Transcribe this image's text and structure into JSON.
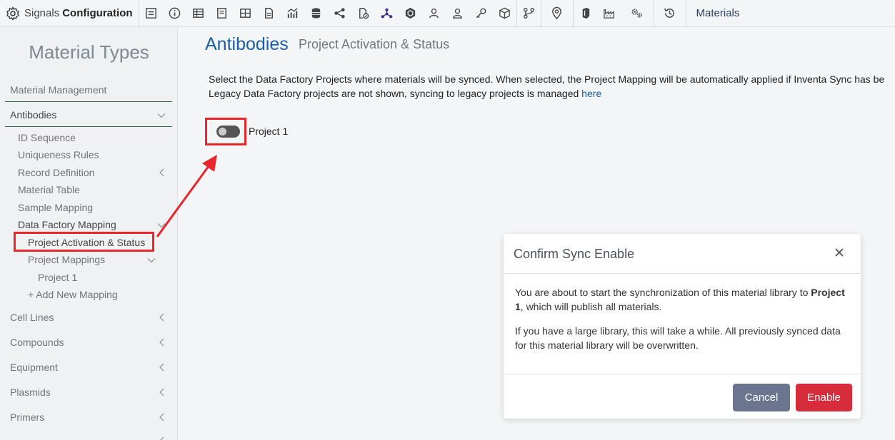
{
  "topbar": {
    "brand_prefix": "Signals",
    "brand_name": "Configuration",
    "section_label": "Materials",
    "icons": [
      "gear-icon",
      "form-icon",
      "info-icon",
      "table-icon",
      "notebook-icon",
      "grid-icon",
      "document-icon",
      "chart-icon",
      "database-icon",
      "share-icon",
      "doc-check-icon",
      "network-icon",
      "hexagon-icon",
      "user-group-icon",
      "user-icon",
      "key-icon",
      "cube-icon",
      "workflow-icon",
      "location-icon",
      "shield-icon",
      "factory-icon",
      "gears-icon",
      "history-icon"
    ]
  },
  "sidebar": {
    "title": "Material Types",
    "items": {
      "material_management": "Material Management",
      "antibodies": "Antibodies",
      "id_sequence": "ID Sequence",
      "uniqueness_rules": "Uniqueness Rules",
      "record_definition": "Record Definition",
      "material_table": "Material Table",
      "sample_mapping": "Sample Mapping",
      "data_factory_mapping": "Data Factory Mapping",
      "project_activation": "Project Activation & Status",
      "project_mappings": "Project Mappings",
      "project_1": "Project 1",
      "add_new_mapping": "+ Add New Mapping",
      "cell_lines": "Cell Lines",
      "compounds": "Compounds",
      "equipment": "Equipment",
      "plasmids": "Plasmids",
      "primers": "Primers"
    }
  },
  "main": {
    "title": "Antibodies",
    "subtitle": "Project Activation & Status",
    "desc_line1": "Select the Data Factory Projects where materials will be synced. When selected, the Project Mapping will be automatically applied if Inventa Sync has be",
    "desc_line2_prefix": "Legacy Data Factory projects are not shown, syncing to legacy projects is managed ",
    "desc_link": "here",
    "toggle_label": "Project 1",
    "toggle_on": false
  },
  "modal": {
    "title": "Confirm Sync Enable",
    "body1_prefix": "You are about to start the synchronization of this material library to ",
    "body1_bold": "Project 1",
    "body1_suffix": ", which will publish all materials.",
    "body2": "If you have a large library, this will take a while. All previously synced data for this material library will be overwritten.",
    "cancel_label": "Cancel",
    "enable_label": "Enable"
  },
  "colors": {
    "accent_blue": "#1a5fa8",
    "highlight_red": "#e8262c",
    "enable_red": "#d72c3c",
    "cancel_grey": "#6b7590"
  }
}
